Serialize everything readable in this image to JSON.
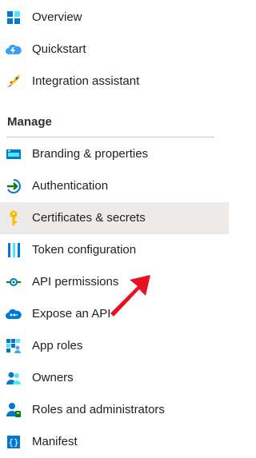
{
  "top_items": [
    {
      "label": "Overview",
      "icon": "grid-overview-icon"
    },
    {
      "label": "Quickstart",
      "icon": "cloud-lightning-icon"
    },
    {
      "label": "Integration assistant",
      "icon": "rocket-icon"
    }
  ],
  "manage": {
    "title": "Manage",
    "items": [
      {
        "label": "Branding & properties",
        "icon": "branding-window-icon"
      },
      {
        "label": "Authentication",
        "icon": "authentication-arrow-icon"
      },
      {
        "label": "Certificates & secrets",
        "icon": "key-icon",
        "selected": true
      },
      {
        "label": "Token configuration",
        "icon": "token-bars-icon"
      },
      {
        "label": "API permissions",
        "icon": "api-permissions-icon"
      },
      {
        "label": "Expose an API",
        "icon": "expose-api-cloud-icon"
      },
      {
        "label": "App roles",
        "icon": "app-roles-grid-icon"
      },
      {
        "label": "Owners",
        "icon": "owners-people-icon"
      },
      {
        "label": "Roles and administrators",
        "icon": "roles-admin-icon"
      },
      {
        "label": "Manifest",
        "icon": "manifest-braces-icon"
      }
    ]
  },
  "colors": {
    "selected_bg": "#edebe9",
    "arrow": "#e81123",
    "azure_blue": "#0078d4"
  }
}
